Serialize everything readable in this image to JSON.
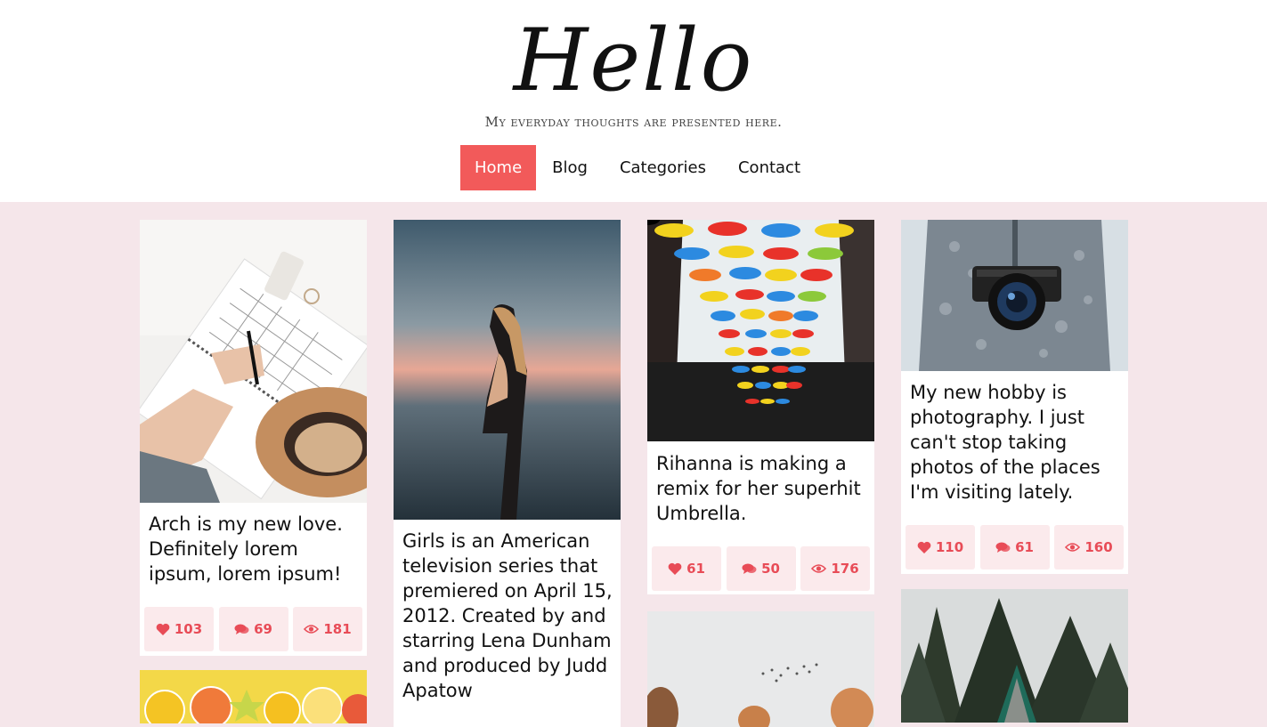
{
  "header": {
    "logo": "Hello",
    "tagline": "My everyday thoughts are presented here."
  },
  "nav": {
    "items": [
      {
        "label": "Home",
        "active": true
      },
      {
        "label": "Blog"
      },
      {
        "label": "Categories"
      },
      {
        "label": "Contact"
      }
    ]
  },
  "colors": {
    "accent": "#f25a5a",
    "page_bg": "#f5e6ea",
    "stat_bg": "#fbeaec",
    "stat_text": "#e84c57"
  },
  "posts": [
    {
      "text": "Arch is my new love. Definitely lorem ipsum, lorem ipsum!",
      "likes": "103",
      "comments": "69",
      "views": "181",
      "image": "planner-hands-hat-photo"
    },
    {
      "text": "Girls is an American television series that premiered on April 15, 2012. Created by and starring Lena Dunham and produced by Judd Apatow",
      "image": "woman-sunset-photo"
    },
    {
      "text": "Rihanna is making a remix for her superhit Umbrella.",
      "likes": "61",
      "comments": "50",
      "views": "176",
      "image": "umbrellas-photo"
    },
    {
      "text": "My new hobby is photography. I just can't stop taking photos of the places I'm visiting lately.",
      "likes": "110",
      "comments": "61",
      "views": "160",
      "image": "camera-sweater-photo"
    },
    {
      "image": "citrus-fruits-photo"
    },
    {
      "image": "autumn-trees-birds-photo"
    },
    {
      "image": "forest-cabin-photo"
    }
  ],
  "icons": {
    "like": "heart-icon",
    "comment": "comments-icon",
    "view": "eye-icon"
  }
}
